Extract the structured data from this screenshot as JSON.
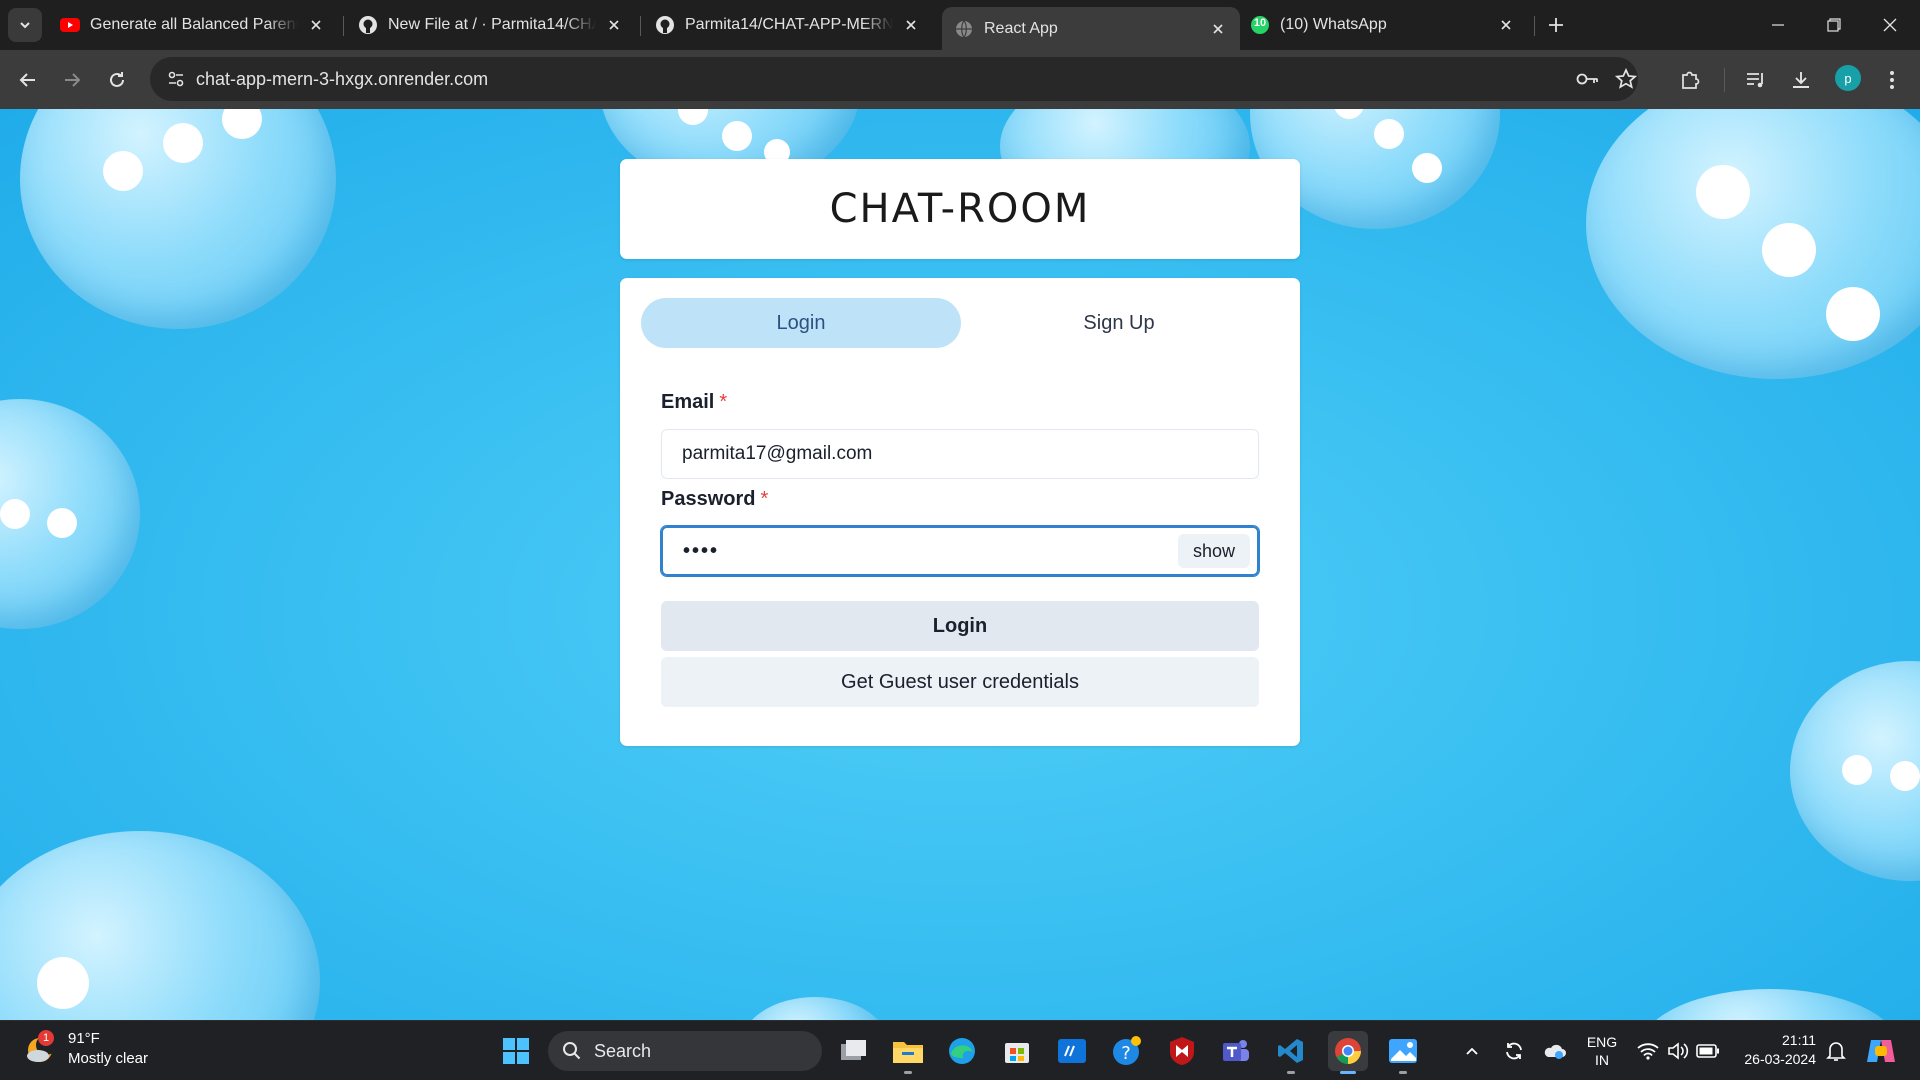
{
  "browser": {
    "tabs": [
      {
        "title": "Generate all Balanced Parenthe",
        "icon": "youtube-icon",
        "active": false
      },
      {
        "title": "New File at / · Parmita14/CHAT",
        "icon": "github-icon",
        "active": false
      },
      {
        "title": "Parmita14/CHAT-APP-MERN: Cl",
        "icon": "github-icon",
        "active": false
      },
      {
        "title": "React App",
        "icon": "globe-icon",
        "active": true
      },
      {
        "title": "(10) WhatsApp",
        "icon": "whatsapp-icon",
        "active": false
      }
    ],
    "whatsapp_badge": "10",
    "url": "chat-app-mern-3-hxgx.onrender.com",
    "profile_initial": "p"
  },
  "app": {
    "title": "CHAT-ROOM",
    "tabs": {
      "login": "Login",
      "signup": "Sign Up"
    },
    "email": {
      "label": "Email",
      "required_mark": "*",
      "value": "parmita17@gmail.com"
    },
    "password": {
      "label": "Password",
      "required_mark": "*",
      "value_masked": "••••",
      "show_label": "show"
    },
    "login_button": "Login",
    "guest_button": "Get Guest user credentials"
  },
  "taskbar": {
    "weather": {
      "temp": "91°F",
      "condition": "Mostly clear",
      "badge": "1"
    },
    "search_placeholder": "Search",
    "language": {
      "line1": "ENG",
      "line2": "IN"
    },
    "clock": {
      "time": "21:11",
      "date": "26-03-2024"
    }
  },
  "colors": {
    "page_bg": "#2fb6ee",
    "tab_selected_bg": "#bee3f8",
    "required": "#e53e3e",
    "focus": "#3182ce"
  }
}
